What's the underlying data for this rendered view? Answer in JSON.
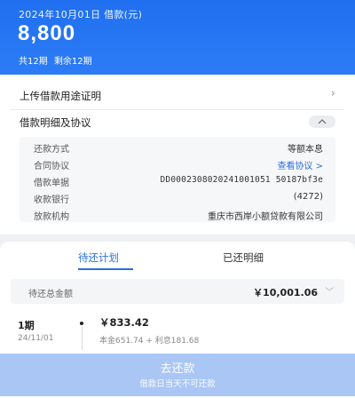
{
  "header": {
    "date_line": "2024年10月01日 借款(元)",
    "amount": "8,800",
    "total_periods": "共12期",
    "remaining_periods": "剩余12期"
  },
  "upload_row": {
    "label": "上传借款用途证明",
    "chevron": "›"
  },
  "detail_row": {
    "label": "借款明细及协议"
  },
  "details": [
    {
      "key": "还款方式",
      "value": "等额本息"
    },
    {
      "key": "合同协议",
      "value": "查看协议 >"
    },
    {
      "key": "借款单据",
      "value": "DD0002308020241001051 50187bf3e"
    },
    {
      "key": "收款银行",
      "value": "(4272)"
    },
    {
      "key": "放款机构",
      "value": "重庆市西岸小额贷款有限公司"
    }
  ],
  "tabs": {
    "pending": "待还计划",
    "done": "已还明细"
  },
  "total": {
    "label": "待还总金额",
    "value": "￥10,001.06",
    "caret": "﹀"
  },
  "installment": {
    "period": "1期",
    "date": "24/11/01",
    "amount": "￥833.42",
    "breakdown": "本金651.74 + 利息181.68"
  },
  "repay_button": {
    "label": "去还款",
    "note": "借款日当天不可还款"
  },
  "colors": {
    "primary": "#2a6fe0",
    "header": "#1f6ff0",
    "button_disabled": "#a9c6f5"
  }
}
